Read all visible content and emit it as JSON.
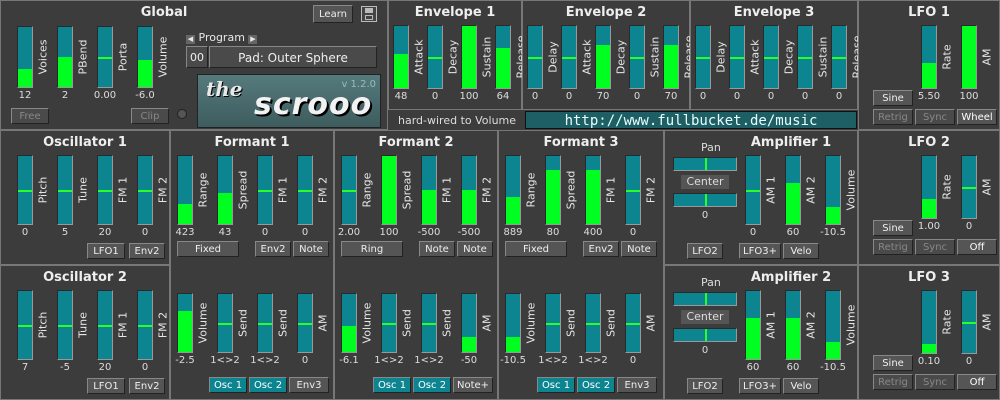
{
  "global": {
    "title": "Global",
    "learn_label": "Learn",
    "save_icon": "floppy-disk-icon",
    "program_label": "Program",
    "program_number": "00",
    "program_name": "Pad: Outer Sphere",
    "sliders": [
      {
        "label": "Voices",
        "value": "12",
        "level": 0.3
      },
      {
        "label": "PBend",
        "value": "2",
        "level": 0.5
      },
      {
        "label": "Porta",
        "value": "0.00",
        "level": 0
      },
      {
        "label": "Volume",
        "value": "-6.0",
        "level": 0.45
      }
    ],
    "free_label": "Free",
    "clip_label": "Clip",
    "logo_the": "the",
    "logo_name": "scrooo",
    "version": "v 1.2.0",
    "hardwired": "hard-wired to Volume",
    "url": "http://www.fullbucket.de/music"
  },
  "envelopes": [
    {
      "title": "Envelope 1",
      "sliders": [
        {
          "label": "Attack",
          "value": "48",
          "level": 0.55
        },
        {
          "label": "Decay",
          "value": "0",
          "level": 0
        },
        {
          "label": "Sustain",
          "value": "100",
          "level": 1.0
        },
        {
          "label": "Release",
          "value": "64",
          "level": 0.65
        }
      ]
    },
    {
      "title": "Envelope 2",
      "sliders": [
        {
          "label": "Delay",
          "value": "0",
          "level": 0
        },
        {
          "label": "Attack",
          "value": "0",
          "level": 0
        },
        {
          "label": "Decay",
          "value": "70",
          "level": 0.7
        },
        {
          "label": "Sustain",
          "value": "0",
          "level": 0
        },
        {
          "label": "Release",
          "value": "70",
          "level": 0.7
        }
      ]
    },
    {
      "title": "Envelope 3",
      "sliders": [
        {
          "label": "Delay",
          "value": "0",
          "level": 0
        },
        {
          "label": "Attack",
          "value": "0",
          "level": 0
        },
        {
          "label": "Decay",
          "value": "0",
          "level": 0
        },
        {
          "label": "Sustain",
          "value": "0",
          "level": 0
        },
        {
          "label": "Release",
          "value": "0",
          "level": 0
        }
      ]
    }
  ],
  "lfos": [
    {
      "title": "LFO 1",
      "rate_label": "Rate",
      "rate_value": "5.50",
      "rate_level": 0.4,
      "am_label": "AM",
      "am_value": "100",
      "am_level": 1.0,
      "wave": "Sine",
      "retrig": "Retrig",
      "sync": "Sync",
      "mod": "Wheel"
    },
    {
      "title": "LFO 2",
      "rate_label": "Rate",
      "rate_value": "1.00",
      "rate_level": 0.3,
      "am_label": "AM",
      "am_value": "0",
      "am_level": 0,
      "wave": "Sine",
      "retrig": "Retrig",
      "sync": "Sync",
      "mod": "Off"
    },
    {
      "title": "LFO 3",
      "rate_label": "Rate",
      "rate_value": "0.10",
      "rate_level": 0.15,
      "am_label": "AM",
      "am_value": "0",
      "am_level": 0,
      "wave": "Sine",
      "retrig": "Retrig",
      "sync": "Sync",
      "mod": "Off"
    }
  ],
  "oscillators": [
    {
      "title": "Oscillator 1",
      "sliders": [
        {
          "label": "Pitch",
          "value": "0",
          "level": 0
        },
        {
          "label": "Tune",
          "value": "5",
          "level": 0
        },
        {
          "label": "FM 1",
          "value": "20",
          "level": 0
        },
        {
          "label": "FM 2",
          "value": "0",
          "level": 0
        }
      ],
      "buttons": [
        "LFO1",
        "Env2"
      ]
    },
    {
      "title": "Oscillator 2",
      "sliders": [
        {
          "label": "Pitch",
          "value": "7",
          "level": 0
        },
        {
          "label": "Tune",
          "value": "-5",
          "level": 0
        },
        {
          "label": "FM 1",
          "value": "20",
          "level": 0
        },
        {
          "label": "FM 2",
          "value": "0",
          "level": 0
        }
      ],
      "buttons": [
        "LFO1",
        "Env2"
      ]
    }
  ],
  "formants": [
    {
      "title": "Formant 1",
      "sliders": [
        {
          "label": "Range",
          "value": "423",
          "level": 0.3
        },
        {
          "label": "Spread",
          "value": "43",
          "level": 0.45
        },
        {
          "label": "FM 1",
          "value": "0",
          "level": 0
        },
        {
          "label": "FM 2",
          "value": "0",
          "level": 0
        }
      ],
      "mode": "Fixed",
      "buttons": [
        "Env2",
        "Note"
      ]
    },
    {
      "title": "Formant 2",
      "sliders": [
        {
          "label": "Range",
          "value": "2.00",
          "level": 0
        },
        {
          "label": "Spread",
          "value": "100",
          "level": 1.0
        },
        {
          "label": "FM 1",
          "value": "-500",
          "level": 0.5
        },
        {
          "label": "FM 2",
          "value": "-500",
          "level": 0.5
        }
      ],
      "mode": "Ring",
      "buttons": [
        "Note",
        "Note"
      ]
    },
    {
      "title": "Formant 3",
      "sliders": [
        {
          "label": "Range",
          "value": "889",
          "level": 0.4
        },
        {
          "label": "Spread",
          "value": "80",
          "level": 0.8
        },
        {
          "label": "FM 1",
          "value": "400",
          "level": 0.8
        },
        {
          "label": "FM 2",
          "value": "0",
          "level": 0
        }
      ],
      "mode": "Fixed",
      "buttons": [
        "Env2",
        "Note"
      ]
    }
  ],
  "amp_sections": [
    {
      "sliders": [
        {
          "label": "Volume",
          "value": "-2.5",
          "level": 0.7
        },
        {
          "label": "Send",
          "value": "1<>2",
          "level": 0
        },
        {
          "label": "Send",
          "value": "1<>2",
          "level": 0
        },
        {
          "label": "AM",
          "value": "0",
          "level": 0
        }
      ],
      "buttons": [
        "Osc 1",
        "Osc 2",
        "Env3"
      ]
    },
    {
      "sliders": [
        {
          "label": "Volume",
          "value": "-6.1",
          "level": 0.45
        },
        {
          "label": "Send",
          "value": "1<>2",
          "level": 0
        },
        {
          "label": "Send",
          "value": "1<>2",
          "level": 0
        },
        {
          "label": "AM",
          "value": "-50",
          "level": 0.25
        }
      ],
      "buttons": [
        "Osc 1",
        "Osc 2",
        "Note+"
      ]
    },
    {
      "sliders": [
        {
          "label": "Volume",
          "value": "-10.5",
          "level": 0.25
        },
        {
          "label": "Send",
          "value": "1<>2",
          "level": 0
        },
        {
          "label": "Send",
          "value": "1<>2",
          "level": 0
        },
        {
          "label": "AM",
          "value": "0",
          "level": 0
        }
      ],
      "buttons": [
        "Osc 1",
        "Osc 2",
        "Env3"
      ]
    }
  ],
  "amplifiers": [
    {
      "title": "Amplifier 1",
      "pan_label": "Pan",
      "pan_value": "Center",
      "width_value": "0",
      "sliders": [
        {
          "label": "AM 1",
          "value": "0",
          "level": 0
        },
        {
          "label": "AM 2",
          "value": "60",
          "level": 0.6
        },
        {
          "label": "Volume",
          "value": "-10.5",
          "level": 0.25
        }
      ],
      "buttons": [
        "LFO2",
        "LFO3+",
        "Velo"
      ]
    },
    {
      "title": "Amplifier 2",
      "pan_label": "Pan",
      "pan_value": "Center",
      "width_value": "0",
      "sliders": [
        {
          "label": "AM 1",
          "value": "60",
          "level": 0.6
        },
        {
          "label": "AM 2",
          "value": "60",
          "level": 0.6
        },
        {
          "label": "Volume",
          "value": "-10.5",
          "level": 0.25
        }
      ],
      "buttons": [
        "LFO2",
        "LFO3+",
        "Velo"
      ]
    }
  ],
  "colors": {
    "panel": "#3c3c3c",
    "slider": "#0d8590",
    "fill": "#00ff21",
    "url_bg": "#1e5f66"
  }
}
